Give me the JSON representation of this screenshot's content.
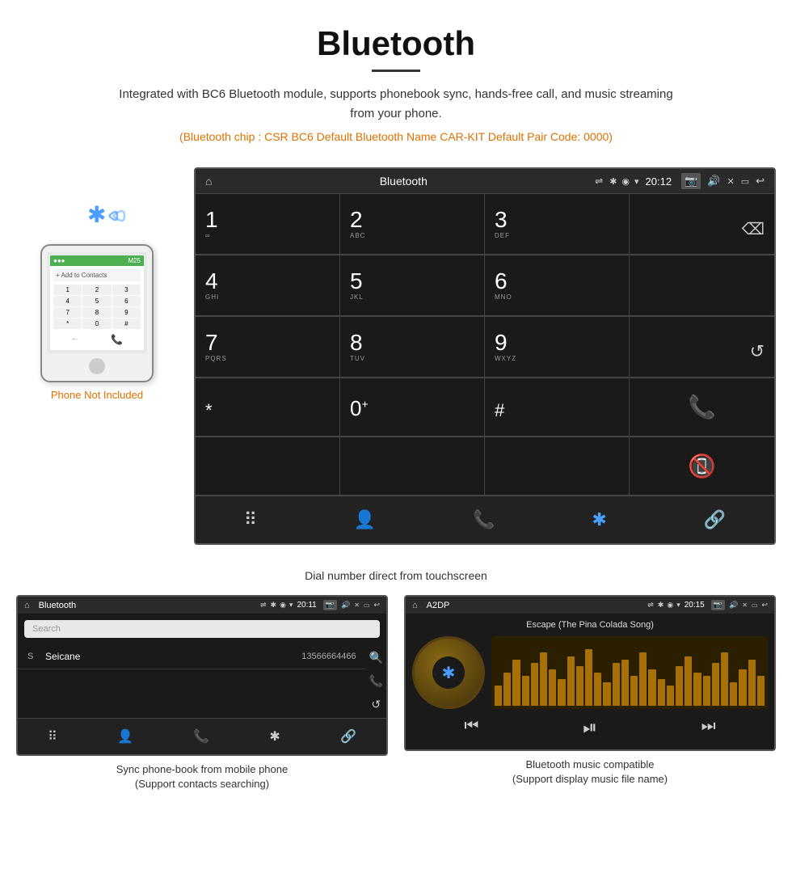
{
  "page": {
    "title": "Bluetooth",
    "underline": true,
    "description": "Integrated with BC6 Bluetooth module, supports phonebook sync, hands-free call, and music streaming from your phone.",
    "specs": "(Bluetooth chip : CSR BC6    Default Bluetooth Name CAR-KIT    Default Pair Code: 0000)",
    "dial_caption": "Dial number direct from touchscreen",
    "phone_label": "Phone Not Included",
    "caption_left": "Sync phone-book from mobile phone\n(Support contacts searching)",
    "caption_right": "Bluetooth music compatible\n(Support display music file name)"
  },
  "status_bar_main": {
    "title": "Bluetooth",
    "time": "20:12",
    "icons": [
      "⌂",
      "⇌",
      "✿",
      "❋",
      "✕",
      "▭",
      "↩"
    ]
  },
  "dialpad": {
    "rows": [
      [
        {
          "num": "1",
          "sub": "∞",
          "type": "digit"
        },
        {
          "num": "2",
          "sub": "ABC",
          "type": "digit"
        },
        {
          "num": "3",
          "sub": "DEF",
          "type": "digit"
        },
        {
          "num": "",
          "sub": "",
          "type": "backspace"
        }
      ],
      [
        {
          "num": "4",
          "sub": "GHI",
          "type": "digit"
        },
        {
          "num": "5",
          "sub": "JKL",
          "type": "digit"
        },
        {
          "num": "6",
          "sub": "MNO",
          "type": "digit"
        },
        {
          "num": "",
          "sub": "",
          "type": "empty"
        }
      ],
      [
        {
          "num": "7",
          "sub": "PQRS",
          "type": "digit"
        },
        {
          "num": "8",
          "sub": "TUV",
          "type": "digit"
        },
        {
          "num": "9",
          "sub": "WXYZ",
          "type": "digit"
        },
        {
          "num": "",
          "sub": "",
          "type": "reload"
        }
      ],
      [
        {
          "num": "*",
          "sub": "",
          "type": "symbol"
        },
        {
          "num": "0",
          "sub": "+",
          "type": "zero"
        },
        {
          "num": "#",
          "sub": "",
          "type": "symbol"
        },
        {
          "num": "",
          "sub": "",
          "type": "call-green"
        }
      ],
      [
        {
          "num": "",
          "sub": "",
          "type": "call-red"
        }
      ]
    ],
    "last_row_icons": [
      "⠿",
      "👤",
      "📞",
      "✱",
      "🔗"
    ]
  },
  "bottom_nav": {
    "icons": [
      "grid",
      "person",
      "phone",
      "bluetooth",
      "link"
    ]
  },
  "phonebook_screen": {
    "status_bar": {
      "title": "Bluetooth",
      "time": "20:11"
    },
    "search_placeholder": "Search",
    "contact": {
      "letter": "S",
      "name": "Seicane",
      "number": "13566664466"
    },
    "right_icons": [
      "search",
      "phone",
      "reload"
    ]
  },
  "music_screen": {
    "status_bar": {
      "title": "A2DP",
      "time": "20:15"
    },
    "song_title": "Escape (The Pina Colada Song)",
    "eq_bars": [
      30,
      50,
      70,
      45,
      65,
      80,
      55,
      40,
      75,
      60,
      85,
      50,
      35,
      65,
      70,
      45,
      80,
      55,
      40,
      30,
      60,
      75,
      50,
      45,
      65,
      80,
      35,
      55,
      70,
      45
    ],
    "controls": [
      "prev",
      "play-pause",
      "next"
    ]
  }
}
